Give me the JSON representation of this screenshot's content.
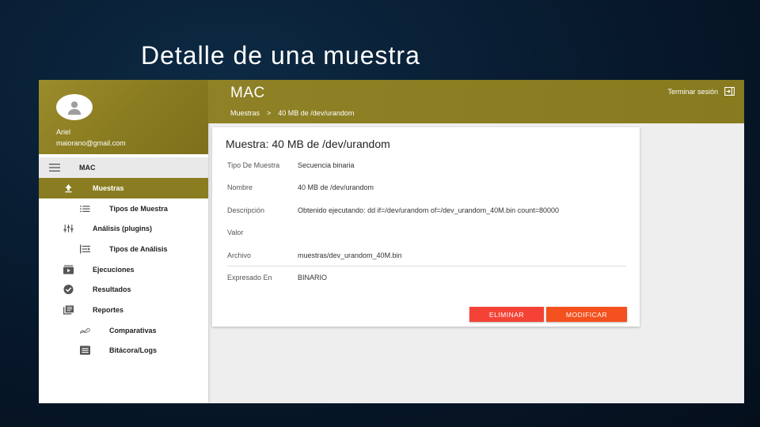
{
  "slide": {
    "title": "Detalle de una muestra"
  },
  "sidebar": {
    "user_name": "Ariel",
    "user_email": "maiorano@gmail.com",
    "header_label": "MAC",
    "items": [
      {
        "label": "Muestras",
        "icon": "upload-icon",
        "active": true,
        "sub": false
      },
      {
        "label": "Tipos de Muestra",
        "icon": "list-icon",
        "active": false,
        "sub": true
      },
      {
        "label": "Análisis (plugins)",
        "icon": "sliders-icon",
        "active": false,
        "sub": false
      },
      {
        "label": "Tipos de Análisis",
        "icon": "list-alt-icon",
        "active": false,
        "sub": true
      },
      {
        "label": "Ejecuciones",
        "icon": "play-box-icon",
        "active": false,
        "sub": false
      },
      {
        "label": "Resultados",
        "icon": "check-circle-icon",
        "active": false,
        "sub": false
      },
      {
        "label": "Reportes",
        "icon": "report-icon",
        "active": false,
        "sub": false
      },
      {
        "label": "Comparativas",
        "icon": "chart-line-icon",
        "active": false,
        "sub": true
      },
      {
        "label": "Bitácora/Logs",
        "icon": "log-icon",
        "active": false,
        "sub": true
      }
    ]
  },
  "topbar": {
    "app_title": "MAC",
    "breadcrumb_root": "Muestras",
    "breadcrumb_sep": ">",
    "breadcrumb_current": "40 MB de /dev/urandom",
    "logout_label": "Terminar sesión"
  },
  "card": {
    "title": "Muestra: 40 MB de /dev/urandom",
    "fields": [
      {
        "label": "Tipo De Muestra",
        "value": "Secuencia binaria"
      },
      {
        "label": "Nombre",
        "value": "40 MB de /dev/urandom"
      },
      {
        "label": "Descripción",
        "value": "Obtenido ejecutando: dd if=/dev/urandom of=/dev_urandom_40M.bin count=80000"
      },
      {
        "label": "Valor",
        "value": ""
      },
      {
        "label": "Archivo",
        "value": "muestras/dev_urandom_40M.bin"
      },
      {
        "label": "Expresado En",
        "value": "BINARIO"
      }
    ],
    "delete_label": "ELIMINAR",
    "modify_label": "MODIFICAR"
  },
  "colors": {
    "primary": "#8a7c20",
    "delete": "#f44336",
    "modify": "#f4511e"
  }
}
